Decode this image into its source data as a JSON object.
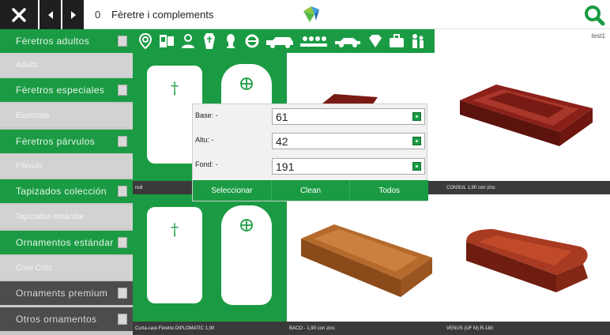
{
  "topbar": {
    "count": "0",
    "title": "Fèretre i complements"
  },
  "user": "test1",
  "toolbar_icons": [
    "location-pin-icon",
    "photos-icon",
    "person-icon",
    "coffin-icon",
    "urn-icon",
    "wreath-icon",
    "hearse-icon",
    "funeral-procession-icon",
    "car-icon",
    "diamond-icon",
    "briefcase-icon",
    "family-icon"
  ],
  "sidebar": {
    "items": [
      {
        "label": "Fèretros adultos",
        "style": "green",
        "plus": true
      },
      {
        "label": "Adults",
        "style": "sub",
        "plus": false
      },
      {
        "label": "Fèretros especiales",
        "style": "green",
        "plus": true
      },
      {
        "label": "Especials",
        "style": "sub",
        "plus": false
      },
      {
        "label": "Fèretros párvulos",
        "style": "green",
        "plus": true
      },
      {
        "label": "Párvuls",
        "style": "sub",
        "plus": false
      },
      {
        "label": "Tapizados colección",
        "style": "green",
        "plus": true
      },
      {
        "label": "Tapizados estándar",
        "style": "sub",
        "plus": false
      },
      {
        "label": "Ornamentos estándar",
        "style": "green",
        "plus": true
      },
      {
        "label": "Creu Crist",
        "style": "sub",
        "plus": false
      },
      {
        "label": "Ornaments premium",
        "style": "dark",
        "plus": true
      },
      {
        "label": "Otros ornamentos",
        "style": "dark",
        "plus": true
      }
    ]
  },
  "products": [
    {
      "caption": "null"
    },
    {
      "caption": ""
    },
    {
      "caption": "CONSUL 1,90 con zinc"
    },
    {
      "caption": "Curta-cast-Fèretre DIPLOMATIC 1,90"
    },
    {
      "caption": "BACO - 1,90 con zinc"
    },
    {
      "caption": "VENUS (UF M) R-180"
    }
  ],
  "filter": {
    "base_label": "Base: -",
    "base_value": "61",
    "altu_label": "Altu: -",
    "altu_value": "42",
    "fond_label": "Fond: -",
    "fond_value": "191",
    "btn_select": "Seleccionar",
    "btn_clean": "Clean",
    "btn_all": "Todos"
  },
  "colors": {
    "brand_green": "#1a9b43",
    "dark": "#1f1f1f",
    "sidebar_dark": "#4c4c4c",
    "sidebar_sub": "#d2d2d2"
  }
}
